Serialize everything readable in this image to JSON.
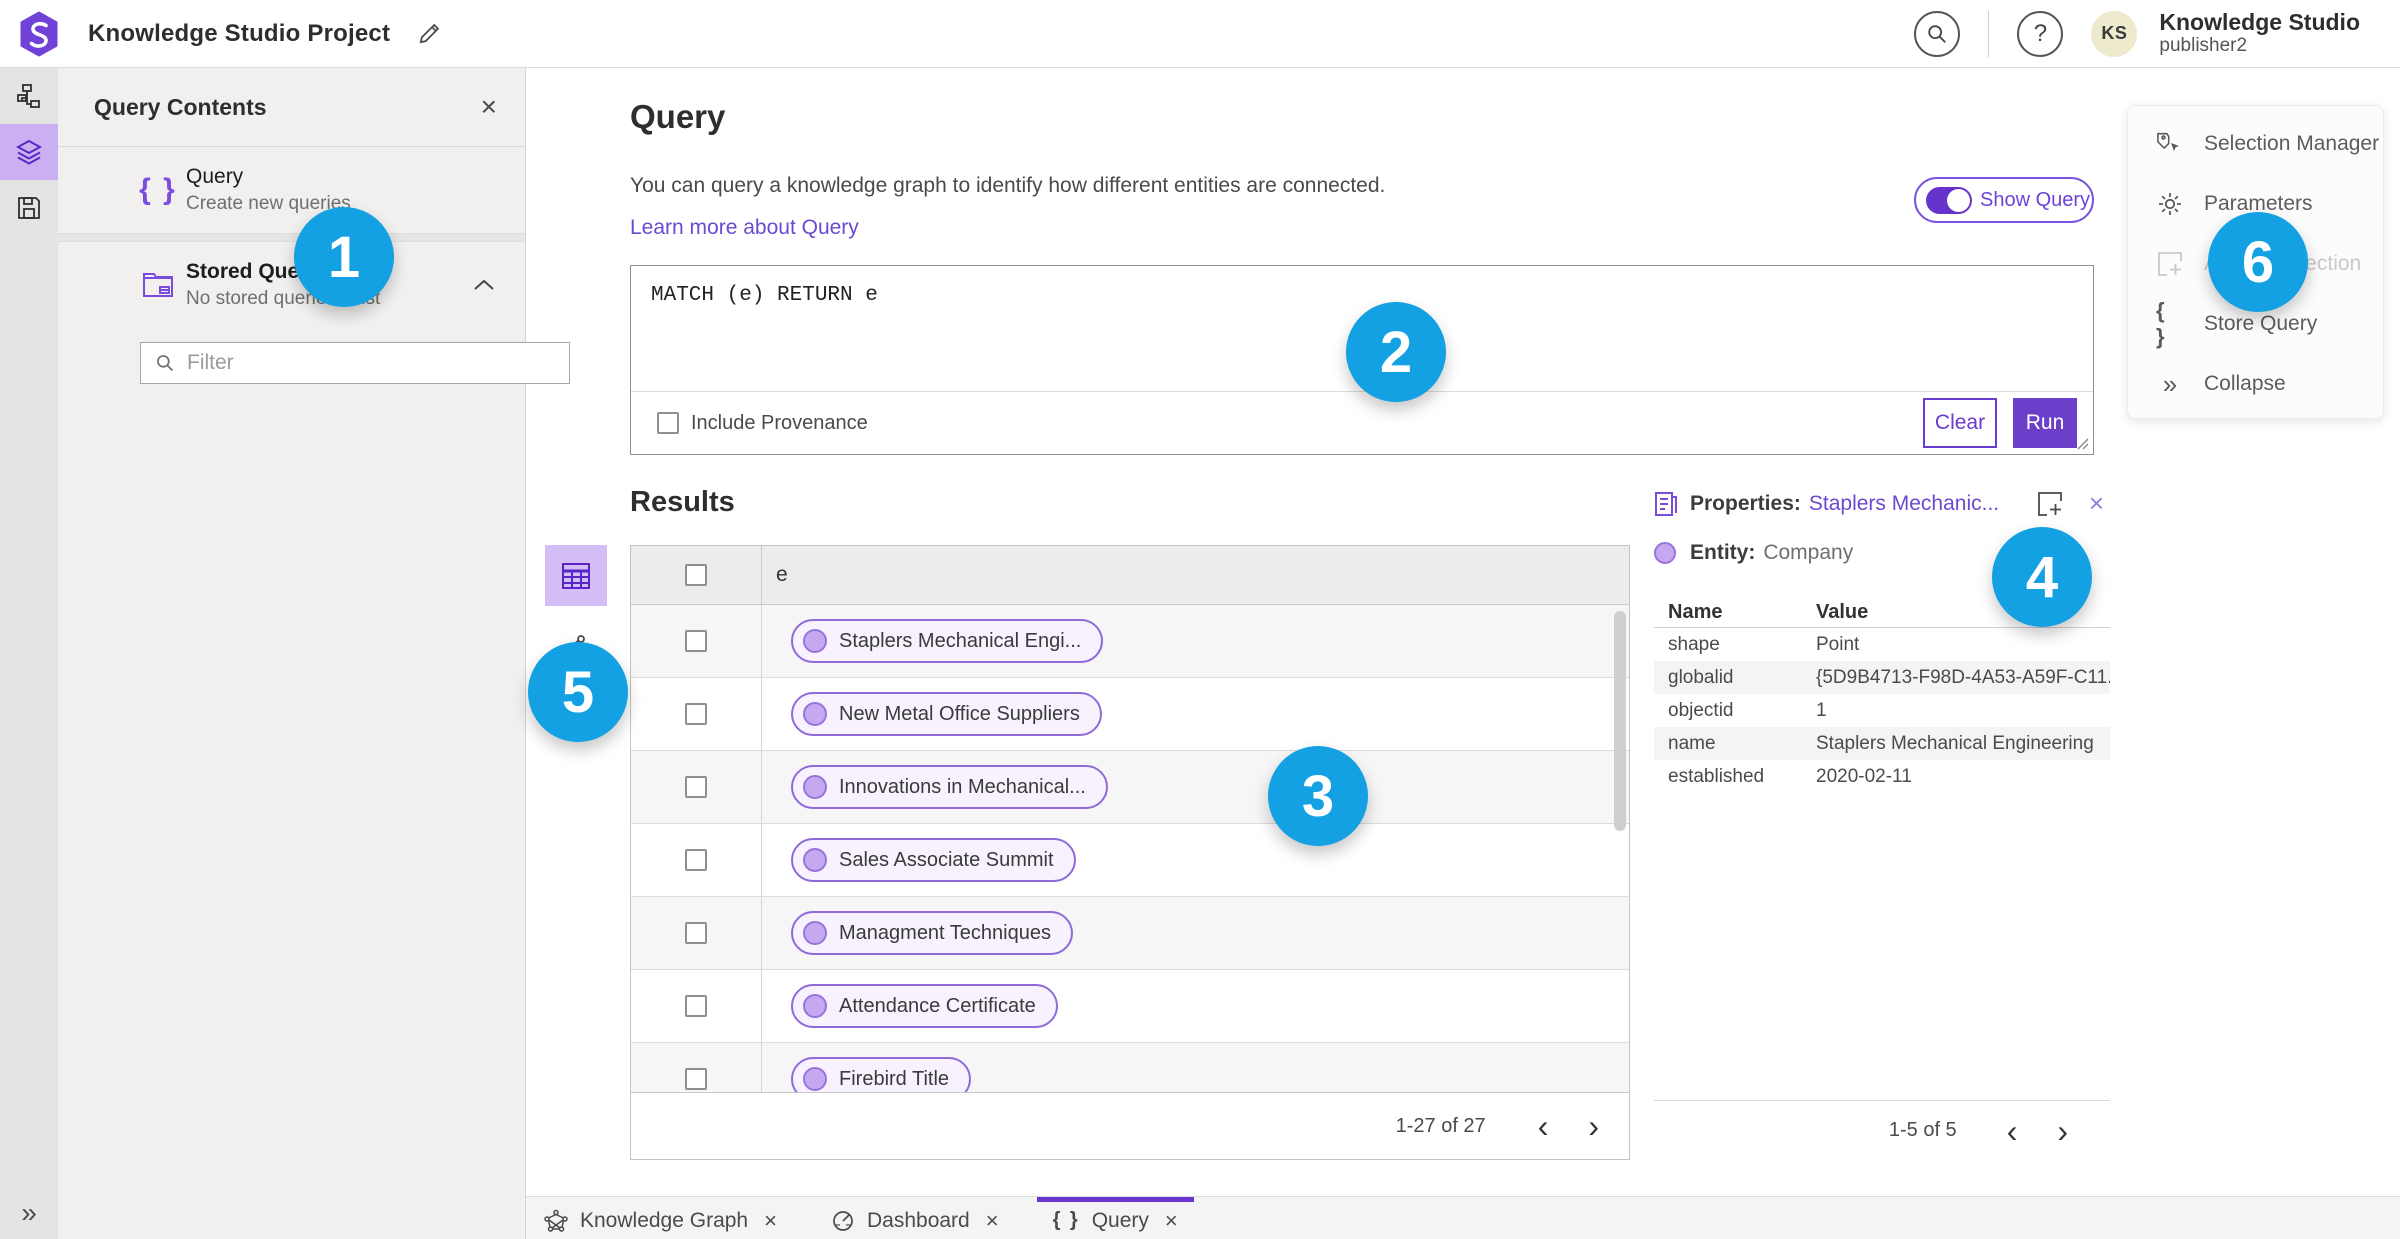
{
  "topbar": {
    "title": "Knowledge Studio Project",
    "help_glyph": "?",
    "avatar_initials": "KS",
    "user_name": "Knowledge Studio",
    "user_role": "publisher2"
  },
  "left_panel": {
    "title": "Query Contents",
    "close_glyph": "×",
    "query_item": {
      "icon_glyph": "{ }",
      "title": "Query",
      "subtitle": "Create new queries"
    },
    "stored_queries": {
      "title": "Stored Queries",
      "subtitle": "No stored queries exist"
    },
    "filter_placeholder": "Filter"
  },
  "query_section": {
    "title": "Query",
    "description": "You can query a knowledge graph to identify how different entities are connected.",
    "link": "Learn more about Query",
    "show_query_label": "Show Query",
    "query_text": "MATCH (e) RETURN e",
    "include_provenance_label": "Include Provenance",
    "clear_label": "Clear",
    "run_label": "Run"
  },
  "results": {
    "title": "Results",
    "column_header": "e",
    "rows": [
      "Staplers Mechanical Engi...",
      "New Metal Office Suppliers",
      "Innovations in Mechanical...",
      "Sales Associate Summit",
      "Managment Techniques",
      "Attendance Certificate",
      "Firebird Title"
    ],
    "pagination": "1-27 of 27",
    "prev_glyph": "‹",
    "next_glyph": "›"
  },
  "properties": {
    "title": "Properties:",
    "entity_link": "Staplers Mechanic...",
    "close_glyph": "×",
    "entity_label": "Entity:",
    "entity_type": "Company",
    "col_name": "Name",
    "col_value": "Value",
    "rows": [
      {
        "name": "shape",
        "value": "Point"
      },
      {
        "name": "globalid",
        "value": "{5D9B4713-F98D-4A53-A59F-C11..."
      },
      {
        "name": "objectid",
        "value": "1"
      },
      {
        "name": "name",
        "value": "Staplers Mechanical Engineering"
      },
      {
        "name": "established",
        "value": "2020-02-11"
      }
    ],
    "pagination": "1-5 of 5",
    "prev_glyph": "‹",
    "next_glyph": "›"
  },
  "right_menu": {
    "selection_manager": "Selection Manager",
    "parameters": "Parameters",
    "add_to_selection": "Add To Selection",
    "store_query_glyph": "{ }",
    "store_query": "Store Query",
    "collapse_glyph": "»",
    "collapse": "Collapse"
  },
  "sidebar": {
    "expand_glyph": "»"
  },
  "tabs": [
    {
      "label": "Knowledge Graph",
      "close_glyph": "×"
    },
    {
      "label": "Dashboard",
      "close_glyph": "×"
    },
    {
      "icon_glyph": "{ }",
      "label": "Query",
      "close_glyph": "×"
    }
  ],
  "annotations": {
    "n1": "1",
    "n2": "2",
    "n3": "3",
    "n4": "4",
    "n5": "5",
    "n6": "6"
  },
  "colors": {
    "accent_purple": "#6a3bd1",
    "run_button": "#6b3fc9",
    "link_purple": "#6c49cf",
    "selected_light_purple": "#cab0f2",
    "annotation_blue": "#14a1e3",
    "avatar_bg": "#edeacd",
    "panel_bg": "#f1f0ef"
  }
}
